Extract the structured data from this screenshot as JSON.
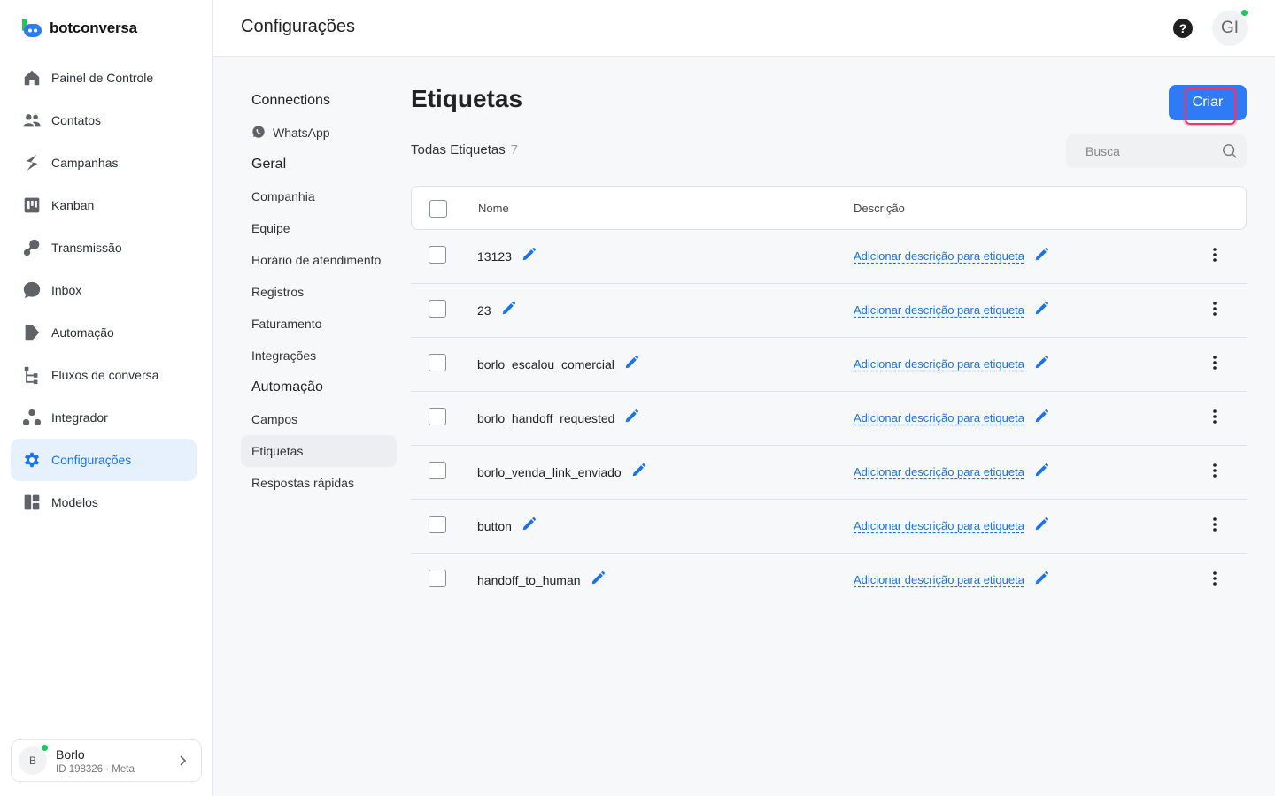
{
  "brand": {
    "name": "botconversa",
    "colors": {
      "primary": "#2f7bf5",
      "logo_green": "#22c55e"
    }
  },
  "sidebar": {
    "items": [
      {
        "label": "Painel de Controle",
        "icon": "home-icon"
      },
      {
        "label": "Contatos",
        "icon": "users-icon"
      },
      {
        "label": "Campanhas",
        "icon": "campaign-icon"
      },
      {
        "label": "Kanban",
        "icon": "kanban-icon"
      },
      {
        "label": "Transmissão",
        "icon": "broadcast-icon"
      },
      {
        "label": "Inbox",
        "icon": "chat-icon"
      },
      {
        "label": "Automação",
        "icon": "automation-icon"
      },
      {
        "label": "Fluxos de conversa",
        "icon": "flow-icon"
      },
      {
        "label": "Integrador",
        "icon": "integrator-icon"
      },
      {
        "label": "Configurações",
        "icon": "gear-icon",
        "active": true
      },
      {
        "label": "Modelos",
        "icon": "templates-icon"
      }
    ],
    "account": {
      "initial": "B",
      "name": "Borlo",
      "sub": "ID 198326 · Meta"
    }
  },
  "header": {
    "title": "Configurações",
    "help": "?",
    "user_initials": "GI"
  },
  "subnav": {
    "sections": [
      {
        "title": "Connections",
        "items": [
          "WhatsApp"
        ]
      },
      {
        "title": "Geral",
        "items": [
          "Companhia",
          "Equipe",
          "Horário de atendimento",
          "Registros",
          "Faturamento",
          "Integrações"
        ]
      },
      {
        "title": "Automação",
        "items": [
          "Campos",
          "Etiquetas",
          "Respostas rápidas"
        ]
      }
    ],
    "active": "Etiquetas"
  },
  "main": {
    "title": "Etiquetas",
    "create_label": "Criar",
    "all_label": "Todas Etiquetas",
    "count": "7",
    "search_placeholder": "Busca",
    "columns": {
      "name": "Nome",
      "description": "Descrição"
    },
    "rows": [
      {
        "name": "13123",
        "desc": "Adicionar descrição para etiqueta"
      },
      {
        "name": "23",
        "desc": "Adicionar descrição para etiqueta"
      },
      {
        "name": "borlo_escalou_comercial",
        "desc": "Adicionar descrição para etiqueta"
      },
      {
        "name": "borlo_handoff_requested",
        "desc": "Adicionar descrição para etiqueta"
      },
      {
        "name": "borlo_venda_link_enviado",
        "desc": "Adicionar descrição para etiqueta"
      },
      {
        "name": "button",
        "desc": "Adicionar descrição para etiqueta"
      },
      {
        "name": "handoff_to_human",
        "desc": "Adicionar descrição para etiqueta"
      }
    ]
  }
}
